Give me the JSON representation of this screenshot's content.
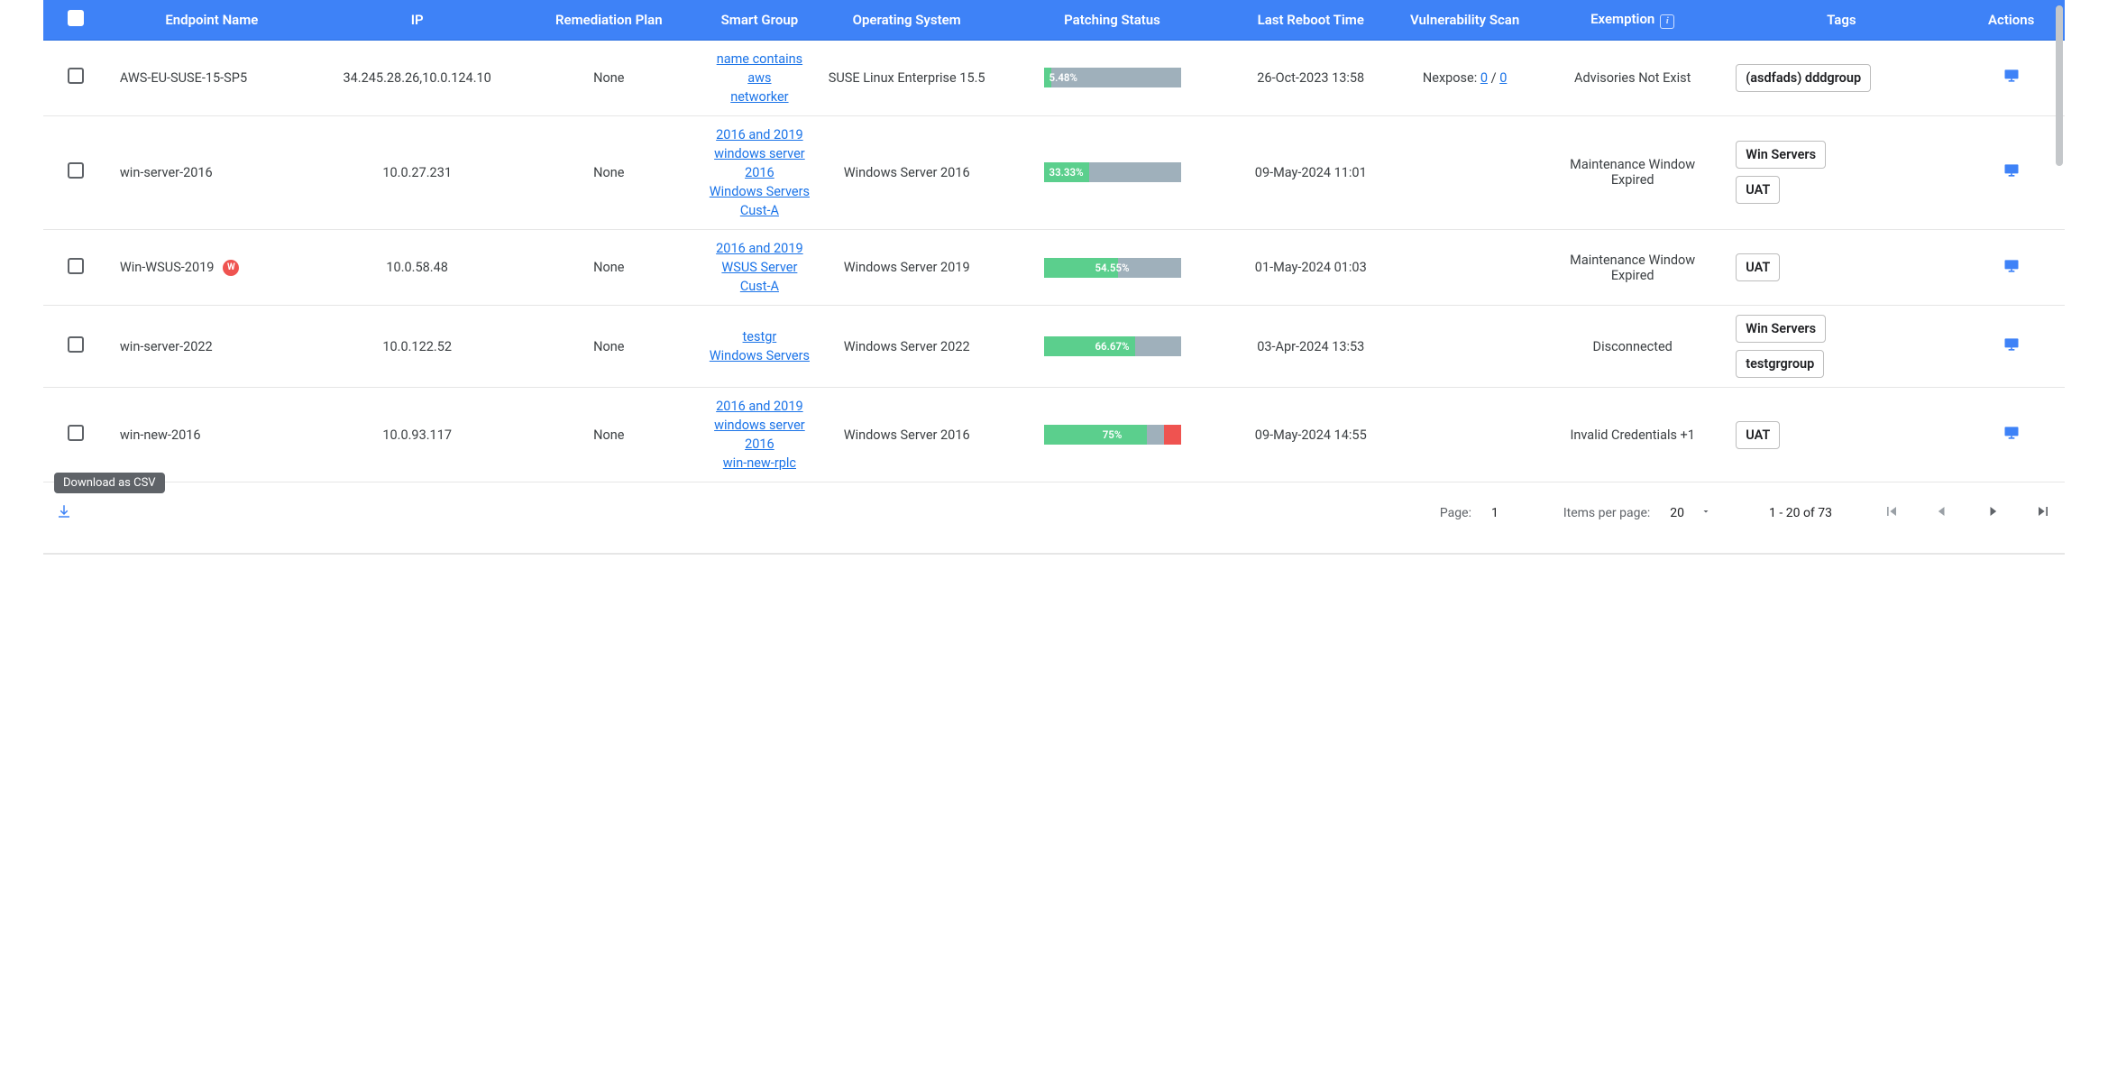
{
  "columns": {
    "checkbox": "",
    "endpoint": "Endpoint Name",
    "ip": "IP",
    "remediation": "Remediation Plan",
    "smartgroup": "Smart Group",
    "os": "Operating System",
    "patching": "Patching Status",
    "reboot": "Last Reboot Time",
    "vuln": "Vulnerability Scan",
    "exemption": "Exemption",
    "tags": "Tags",
    "actions": "Actions"
  },
  "rows": [
    {
      "endpoint": "AWS-EU-SUSE-15-SP5",
      "badge_w": false,
      "ip": "34.245.28.26,10.0.124.10",
      "remediation": "None",
      "smartgroups": [
        "name contains aws",
        "networker"
      ],
      "os": "SUSE Linux Enterprise 15.5",
      "patch_pct": 5.48,
      "patch_pct_label": "5.48%",
      "patch_bad": 0,
      "patch_center": false,
      "reboot": "26-Oct-2023 13:58",
      "vuln_label": "Nexpose: ",
      "vuln_a": "0",
      "vuln_b": "0",
      "vuln_sep": " / ",
      "exemption": "Advisories Not Exist",
      "tags": [
        "(asdfads) dddgroup"
      ]
    },
    {
      "endpoint": "win-server-2016",
      "badge_w": false,
      "ip": "10.0.27.231",
      "remediation": "None",
      "smartgroups": [
        "2016 and 2019",
        "windows server 2016",
        "Windows Servers",
        "Cust-A"
      ],
      "os": "Windows Server 2016",
      "patch_pct": 33.33,
      "patch_pct_label": "33.33%",
      "patch_bad": 0,
      "patch_center": false,
      "reboot": "09-May-2024 11:01",
      "vuln_label": "",
      "vuln_a": "",
      "vuln_b": "",
      "vuln_sep": "",
      "exemption": "Maintenance Window Expired",
      "tags": [
        "Win Servers",
        "UAT"
      ]
    },
    {
      "endpoint": "Win-WSUS-2019",
      "badge_w": true,
      "ip": "10.0.58.48",
      "remediation": "None",
      "smartgroups": [
        "2016 and 2019",
        "WSUS Server",
        "Cust-A"
      ],
      "os": "Windows Server 2019",
      "patch_pct": 54.55,
      "patch_pct_label": "54.55%",
      "patch_bad": 0,
      "patch_center": true,
      "reboot": "01-May-2024 01:03",
      "vuln_label": "",
      "vuln_a": "",
      "vuln_b": "",
      "vuln_sep": "",
      "exemption": "Maintenance Window Expired",
      "tags": [
        "UAT"
      ]
    },
    {
      "endpoint": "win-server-2022",
      "badge_w": false,
      "ip": "10.0.122.52",
      "remediation": "None",
      "smartgroups": [
        "testgr",
        "Windows Servers"
      ],
      "os": "Windows Server 2022",
      "patch_pct": 66.67,
      "patch_pct_label": "66.67%",
      "patch_bad": 0,
      "patch_center": true,
      "reboot": "03-Apr-2024 13:53",
      "vuln_label": "",
      "vuln_a": "",
      "vuln_b": "",
      "vuln_sep": "",
      "exemption": "Disconnected",
      "tags": [
        "Win Servers",
        "testgrgroup"
      ]
    },
    {
      "endpoint": "win-new-2016",
      "badge_w": false,
      "ip": "10.0.93.117",
      "remediation": "None",
      "smartgroups": [
        "2016 and 2019",
        "windows server 2016",
        "win-new-rplc"
      ],
      "os": "Windows Server 2016",
      "patch_pct": 75,
      "patch_pct_label": "75%",
      "patch_bad": 12,
      "patch_center": true,
      "reboot": "09-May-2024 14:55",
      "vuln_label": "",
      "vuln_a": "",
      "vuln_b": "",
      "vuln_sep": "",
      "exemption": "Invalid Credentials +1",
      "tags": [
        "UAT"
      ]
    }
  ],
  "tooltip": "Download as CSV",
  "paginator": {
    "page_label": "Page:",
    "page_value": "1",
    "ipp_label": "Items per page:",
    "ipp_value": "20",
    "range": "1 - 20 of 73"
  },
  "badge_w_text": "W"
}
